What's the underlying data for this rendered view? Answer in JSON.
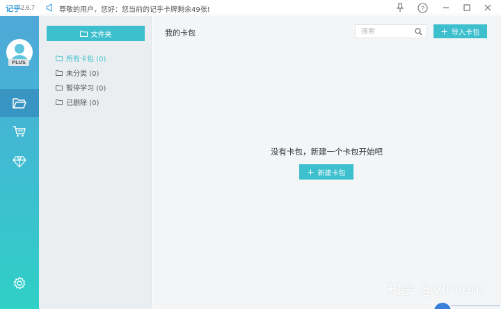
{
  "app": {
    "logo": "记乎",
    "version": "2.6.7",
    "notice": "尊敬的用户，您好：您当前的记乎卡牌剩余49张!",
    "plus_badge": "PLUS"
  },
  "window_controls": {
    "pin_icon": "pin-icon",
    "help_label": "?",
    "minimize_label": "–",
    "maximize_label": "☐",
    "close_label": "✕"
  },
  "rail": {
    "items": [
      {
        "icon": "folder-open-icon",
        "active": true
      },
      {
        "icon": "cart-icon",
        "active": false
      },
      {
        "icon": "diamond-icon",
        "active": false
      },
      {
        "icon": "gear-icon",
        "active": false
      }
    ]
  },
  "folders": {
    "header_button": "文件夹",
    "items": [
      {
        "label": "所有卡包 (0)",
        "active": true
      },
      {
        "label": "未分类 (0)",
        "active": false
      },
      {
        "label": "暂停学习 (0)",
        "active": false
      },
      {
        "label": "已删除 (0)",
        "active": false
      }
    ]
  },
  "main": {
    "title": "我的卡包",
    "search_placeholder": "搜索",
    "import_button": "导入卡包",
    "empty_text": "没有卡包，新建一个卡包开始吧",
    "new_button": "新建卡包",
    "watermark": "知乎 @Vincent"
  },
  "colors": {
    "accent": "#3dbfcd",
    "rail_top": "#4fa8d8",
    "rail_bottom": "#2fd0c6",
    "panel_bg": "#eaeef1",
    "main_bg": "#f3f5f7"
  }
}
